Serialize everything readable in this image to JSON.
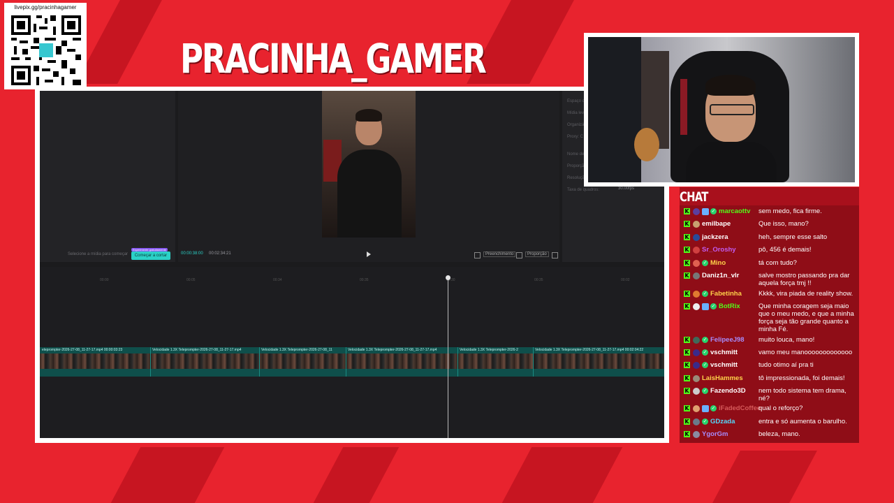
{
  "colors": {
    "background": "#e8232e",
    "chat_bg": "#8f0d17",
    "kick_green": "#53fc18",
    "editor_bg": "#1b1b1d",
    "accent_teal": "#2bd1c7"
  },
  "overlay": {
    "qr_url": "livepix.gg/pracinhagamer",
    "channel_title": "PRACINHA_GAMER",
    "chat_title": "CHAT"
  },
  "editor": {
    "prop_labels": [
      "Espaço d",
      "Mídia lev",
      "Organizá",
      "Proxy: C",
      "Nome de",
      "Proporçã",
      "Resoluçã",
      "Taxa de quadros:"
    ],
    "frame_rate_value": "30.00fps",
    "select_media_hint": "Selecione a mídia para começar",
    "cta_tag": "Experimente gratuitamente",
    "start_cut_button": "Começar a cortar",
    "timecode_current": "00:00:38:00",
    "timecode_total": "00:02:34:21",
    "tool_fill": "Preenchimento",
    "tool_ratio": "Proporção",
    "ruler_ticks": [
      "00:00",
      "00:05",
      "00:34",
      "00:35",
      "00:30",
      "00:35",
      "00:02"
    ],
    "clips": [
      {
        "label": "eleprompter-2026-27-08_11-27-17.mp4  00:00:03:23"
      },
      {
        "label": "Velocidade 1.3X   Teleprompter-2026-27-08_11-27-17.mp4"
      },
      {
        "label": "Velocidade 1.3X   Teleprompter-2026-27-08_11"
      },
      {
        "label": "Velocidade 1.3X   Teleprompter-2026-27-08_11-27-17.mp4"
      },
      {
        "label": "Velocidade 1.3X   Teleprompter-2026-2"
      },
      {
        "label": "Velocidade 1.3X   Teleprompter-2026-27-08_11-27-17.mp4  00:02:04:22"
      }
    ]
  },
  "chat": {
    "messages": [
      {
        "user": "marcaottv",
        "text": "sem medo, fica firme.",
        "color": "#53fc18",
        "avatar": "#5b3fa0",
        "verified": true,
        "extra_badge": true
      },
      {
        "user": "emilbape",
        "text": "Que isso, mano?",
        "color": "#ffffff",
        "avatar": "#c8a070",
        "verified": false,
        "extra_badge": false
      },
      {
        "user": "jackzera",
        "text": "heh, sempre esse salto",
        "color": "#ffffff",
        "avatar": "#2a4a9a",
        "verified": false,
        "extra_badge": false
      },
      {
        "user": "Sr_Oroshy",
        "text": "pô, 456 é demais!",
        "color": "#c25cf0",
        "avatar": "#d04040",
        "verified": false,
        "extra_badge": false
      },
      {
        "user": "Mino",
        "text": "tá com tudo?",
        "color": "#ffd24a",
        "avatar": "#e06050",
        "verified": true,
        "extra_badge": false
      },
      {
        "user": "Daniz1n_vlr",
        "text": "salve mostro passando pra dar aquela força tmj !!",
        "color": "#ffffff",
        "avatar": "#777777",
        "verified": false,
        "extra_badge": false
      },
      {
        "user": "Fabetinha",
        "text": "Kkkk, vira piada de reality show.",
        "color": "#ffd24a",
        "avatar": "#e07a30",
        "verified": true,
        "extra_badge": false
      },
      {
        "user": "BotRix",
        "text": "Que minha coragem seja maio que o meu medo, e que a minha força seja tão grande quanto a minha Fé.",
        "color": "#53fc18",
        "avatar": "#eeeeee",
        "verified": true,
        "extra_badge": true
      },
      {
        "user": "FelipeeJ98",
        "text": "muito louca, mano!",
        "color": "#a78bfa",
        "avatar": "#3f6a5a",
        "verified": true,
        "extra_badge": false
      },
      {
        "user": "vschmitt",
        "text": "vamo meu manooooooooooooo",
        "color": "#ffffff",
        "avatar": "#3a2a8a",
        "verified": true,
        "extra_badge": false
      },
      {
        "user": "vschmitt",
        "text": "tudo otimo aí pra ti",
        "color": "#ffffff",
        "avatar": "#3a2a8a",
        "verified": true,
        "extra_badge": false
      },
      {
        "user": "LaisHammes",
        "text": "tô impressionada, foi demais!",
        "color": "#ffd24a",
        "avatar": "#9a8a7a",
        "verified": false,
        "extra_badge": false
      },
      {
        "user": "Fazendo3D",
        "text": "nem todo sistema tem drama, né?",
        "color": "#ffffff",
        "avatar": "#cccccc",
        "verified": true,
        "extra_badge": false
      },
      {
        "user": "iFadedCoffee",
        "text": "qual o reforço?",
        "color": "#d65a5a",
        "avatar": "#e0a070",
        "verified": true,
        "extra_badge": true
      },
      {
        "user": "GDzada",
        "text": "entra e só aumenta o barulho.",
        "color": "#53d8fb",
        "avatar": "#6a7a8a",
        "verified": true,
        "extra_badge": false
      },
      {
        "user": "YgorGm",
        "text": "beleza, mano.",
        "color": "#a78bfa",
        "avatar": "#8a8aa0",
        "verified": false,
        "extra_badge": false
      }
    ]
  }
}
